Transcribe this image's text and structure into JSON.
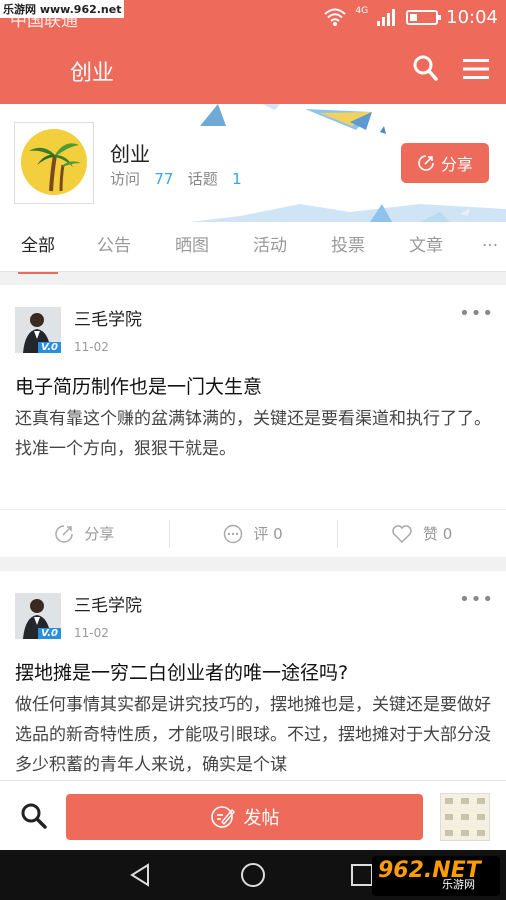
{
  "status_bar": {
    "watermark": "乐游网 www.962.net",
    "carrier": "中国联通",
    "network": "4G",
    "time": "10:04"
  },
  "header": {
    "title": "创业",
    "icons": [
      "search-icon",
      "menu-icon"
    ]
  },
  "group": {
    "name": "创业",
    "visits_label": "访问",
    "visits": "77",
    "topics_label": "话题",
    "topics": "1",
    "share_label": "分享"
  },
  "tabs": [
    {
      "label": "全部",
      "active": true
    },
    {
      "label": "公告",
      "active": false
    },
    {
      "label": "晒图",
      "active": false
    },
    {
      "label": "活动",
      "active": false
    },
    {
      "label": "投票",
      "active": false
    },
    {
      "label": "文章",
      "active": false
    },
    {
      "label": "···",
      "active": false
    }
  ],
  "posts": [
    {
      "author": "三毛学院",
      "badge": "V.0",
      "date": "11-02",
      "title": "电子简历制作也是一门大生意",
      "body": "还真有靠这个赚的盆满钵满的，关键还是要看渠道和执行了了。找准一个方向，狠狠干就是。",
      "share_label": "分享",
      "comment_label": "评 0",
      "like_label": "赞 0"
    },
    {
      "author": "三毛学院",
      "badge": "V.0",
      "date": "11-02",
      "title": "摆地摊是一穷二白创业者的唯一途径吗?",
      "body": "做任何事情其实都是讲究技巧的，摆地摊也是，关键还是要做好选品的新奇特性质，才能吸引眼球。不过，摆地摊对于大部分没多少积蓄的青年人来说，确实是个谋"
    }
  ],
  "bottom": {
    "post_label": "发帖"
  },
  "watermark_bottom": {
    "number": "962.NET",
    "text": "乐游网"
  },
  "colors": {
    "brand": "#ee6a5b",
    "link": "#3aa6e8",
    "badge": "#2b8fe0"
  }
}
